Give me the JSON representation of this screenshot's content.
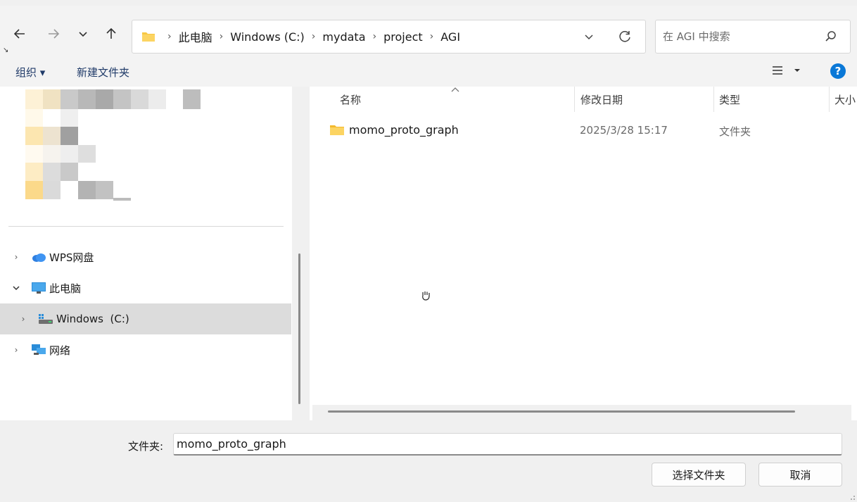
{
  "nav": {
    "back_icon": "arrow-left-icon",
    "forward_icon": "arrow-right-icon",
    "recent_icon": "chevron-down-icon",
    "up_icon": "arrow-up-icon"
  },
  "address": {
    "crumbs": [
      "此电脑",
      "Windows (C:)",
      "mydata",
      "project",
      "AGI"
    ]
  },
  "search": {
    "placeholder": "在 AGI 中搜索"
  },
  "toolbar": {
    "organize": "组织 ▾",
    "new_folder": "新建文件夹"
  },
  "tree": {
    "items": [
      {
        "label": "WPS网盘",
        "expanded": false
      },
      {
        "label": "此电脑",
        "expanded": true
      },
      {
        "label": "Windows  (C:)",
        "expanded": false,
        "selected": true
      },
      {
        "label": "网络",
        "expanded": false
      }
    ]
  },
  "columns": {
    "name": "名称",
    "modified": "修改日期",
    "type": "类型",
    "size": "大小"
  },
  "files": [
    {
      "name": "momo_proto_graph",
      "modified": "2025/3/28 15:17",
      "type": "文件夹"
    }
  ],
  "footer": {
    "folder_label": "文件夹:",
    "folder_value": "momo_proto_graph",
    "select_button": "选择文件夹",
    "cancel_button": "取消"
  },
  "colors": {
    "accent": "#0a78d7",
    "folder": "#f8c743",
    "selection": "#dcdcdc"
  }
}
